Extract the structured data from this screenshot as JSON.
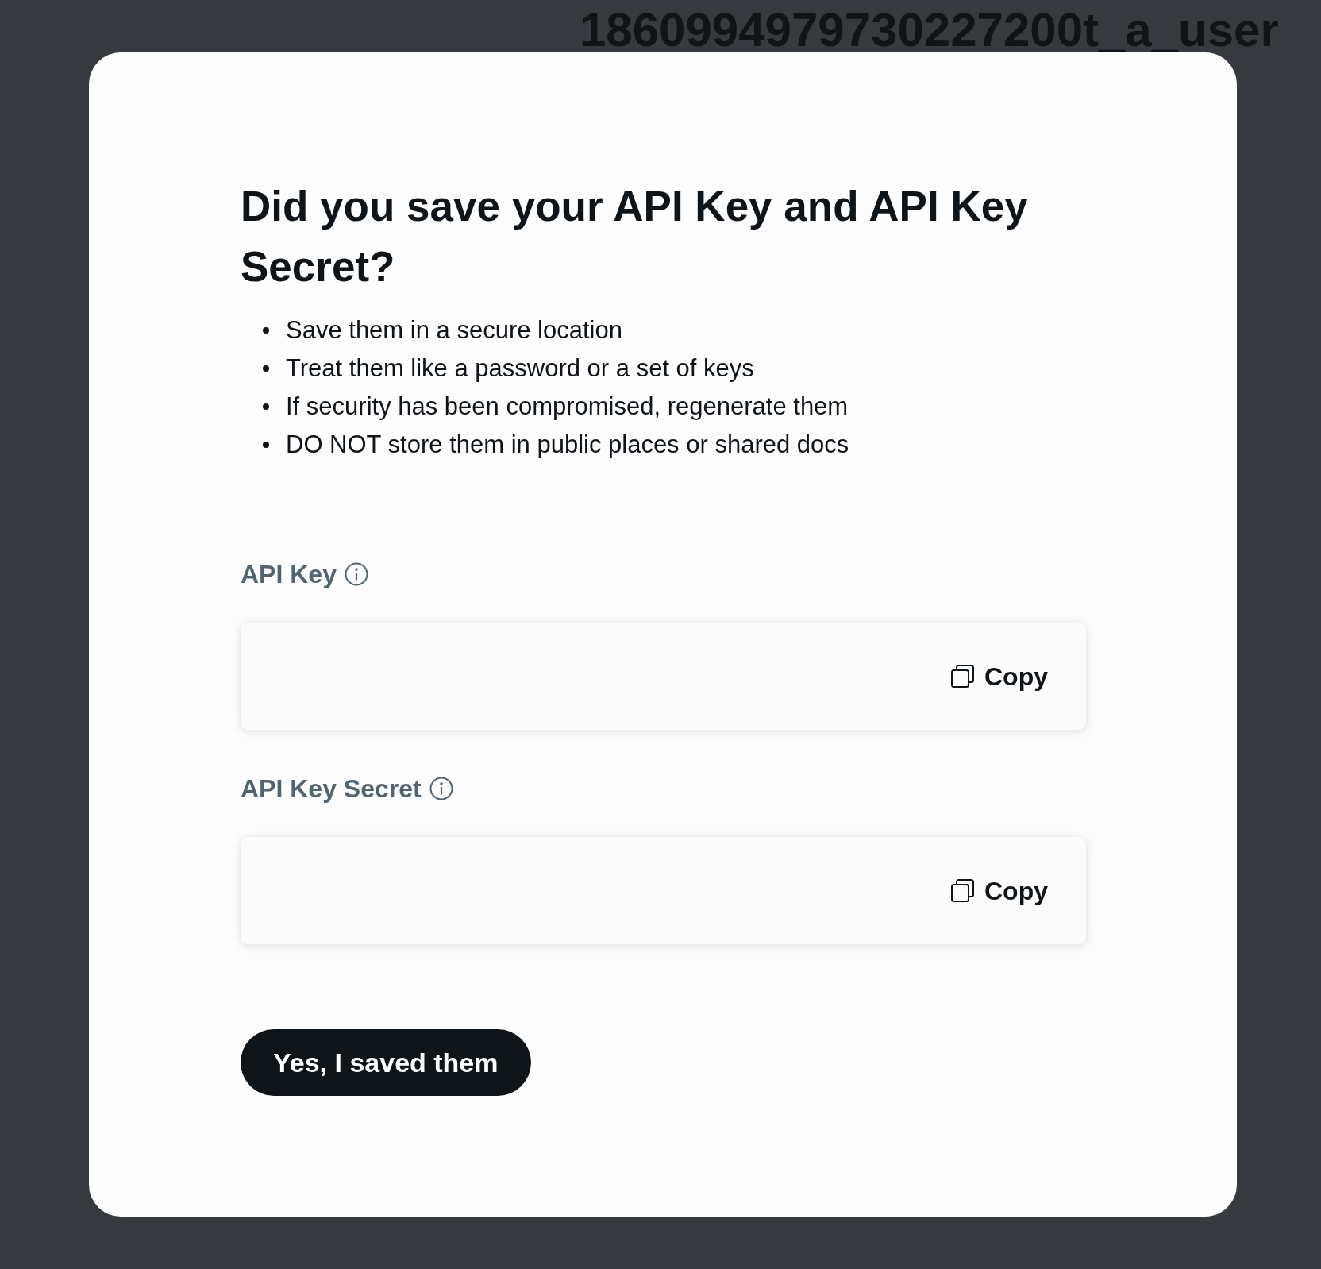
{
  "background": {
    "app_name": "1860994979730227200t_a_user"
  },
  "dialog": {
    "title": "Did you save your API Key and API Key Secret?",
    "tips": [
      "Save them in a secure location",
      "Treat them like a password or a set of keys",
      "If security has been compromised, regenerate them",
      "DO NOT store them in public places or shared docs"
    ],
    "fields": [
      {
        "label": "API Key",
        "copy_label": "Copy"
      },
      {
        "label": "API Key Secret",
        "copy_label": "Copy"
      }
    ],
    "confirm_button": "Yes, I saved them"
  }
}
